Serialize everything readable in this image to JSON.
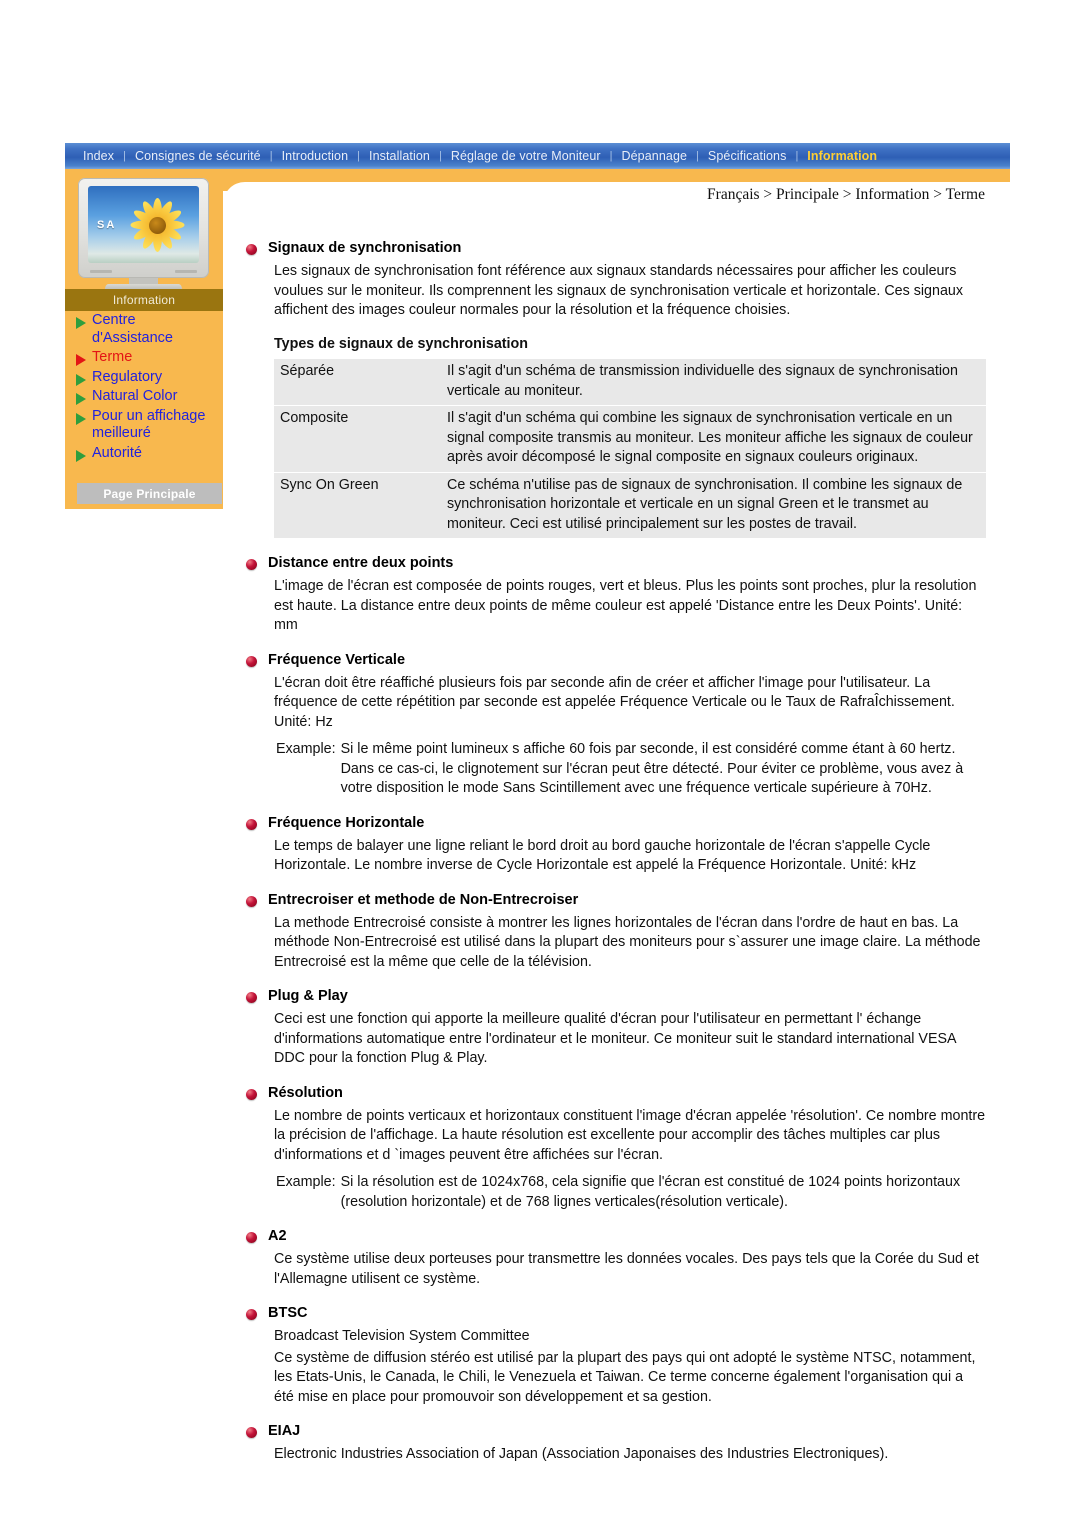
{
  "nav": {
    "items": [
      {
        "label": "Index",
        "active": false
      },
      {
        "label": "Consignes de sécurité",
        "active": false
      },
      {
        "label": "Introduction",
        "active": false
      },
      {
        "label": "Installation",
        "active": false
      },
      {
        "label": "Réglage de votre Moniteur",
        "active": false
      },
      {
        "label": "Dépannage",
        "active": false
      },
      {
        "label": "Spécifications",
        "active": false
      },
      {
        "label": "Information",
        "active": true
      }
    ],
    "separator": "|",
    "active_color": "#ffcf33",
    "bar_color": "#2e5fb5"
  },
  "sidebar": {
    "panel_color": "#f8b84e",
    "monitor": {
      "brand_text": "SA",
      "icon": "crt-monitor-sunflower"
    },
    "section_label": "Information",
    "section_label_bg": "#9a7510",
    "links": [
      {
        "label": "Centre\nd'Assistance",
        "current": false
      },
      {
        "label": "Terme",
        "current": true
      },
      {
        "label": "Regulatory",
        "current": false
      },
      {
        "label": "Natural Color",
        "current": false
      },
      {
        "label": "Pour un affichage\nmeilleuré",
        "current": false
      },
      {
        "label": "Autorité",
        "current": false
      }
    ],
    "link_color": "#2222dd",
    "current_color": "#e31515",
    "main_page_button": "Page Principale"
  },
  "breadcrumb": "Français > Principale > Information > Terme",
  "content": {
    "sections": [
      {
        "title": "Signaux de synchronisation",
        "paragraphs": [
          "Les signaux de synchronisation font référence aux signaux standards nécessaires pour afficher les couleurs voulues sur le moniteur. Ils comprennent les signaux de synchronisation verticale et horizontale. Ces signaux affichent des images couleur normales pour la résolution et la fréquence choisies."
        ],
        "subtitle": "Types de signaux de synchronisation",
        "table": {
          "rows": [
            {
              "key": "Séparée",
              "value": "Il s'agit d'un schéma de transmission individuelle des signaux de synchronisation verticale au moniteur."
            },
            {
              "key": "Composite",
              "value": "Il s'agit d'un schéma qui combine les signaux de synchronisation verticale en un signal composite transmis au moniteur. Les moniteur affiche les signaux de couleur après avoir décomposé le signal composite en signaux couleurs originaux."
            },
            {
              "key": "Sync On Green",
              "value": "Ce schéma n'utilise pas de signaux de synchronisation. Il combine les signaux de synchronisation horizontale et verticale en un signal Green et le transmet au moniteur. Ceci est utilisé principalement sur les postes de travail."
            }
          ]
        }
      },
      {
        "title": "Distance entre deux points",
        "paragraphs": [
          "L'image de l'écran est composée de points rouges, vert et bleus. Plus les points sont proches, plur la resolution est haute. La distance entre deux points de même couleur est appelé 'Distance entre les Deux Points'. Unité: mm"
        ]
      },
      {
        "title": "Fréquence Verticale",
        "paragraphs": [
          "L'écran doit être réaffiché plusieurs fois par seconde afin de créer et afficher l'image pour l'utilisateur. La fréquence de cette répétition par seconde est appelée Fréquence Verticale ou le Taux de RafraÎchissement. Unité: Hz"
        ],
        "example": {
          "key": "Example:",
          "body": "Si le même point lumineux s affiche 60 fois par seconde, il est considéré comme étant à 60 hertz. Dans ce cas-ci, le clignotement sur l'écran peut être détecté. Pour éviter ce problème, vous avez à votre disposition le mode Sans Scintillement avec une fréquence verticale supérieure à 70Hz."
        }
      },
      {
        "title": "Fréquence Horizontale",
        "paragraphs": [
          "Le temps de balayer une ligne reliant le bord droit au bord gauche horizontale de l'écran s'appelle Cycle Horizontale. Le nombre inverse de Cycle Horizontale est appelé la Fréquence Horizontale. Unité: kHz"
        ]
      },
      {
        "title": "Entrecroiser et methode de Non-Entrecroiser",
        "paragraphs": [
          "La methode Entrecroisé consiste à montrer les lignes horizontales de l'écran dans l'ordre de haut en bas. La méthode Non-Entrecroisé est utilisé dans la plupart des moniteurs pour s`assurer une image claire. La méthode Entrecroisé est la même que celle de la télévision."
        ]
      },
      {
        "title": "Plug & Play",
        "paragraphs": [
          "Ceci est une fonction qui apporte la meilleure qualité d'écran pour l'utilisateur en permettant l' échange d'informations automatique entre l'ordinateur et le moniteur. Ce moniteur suit le standard international VESA DDC pour la fonction Plug & Play."
        ]
      },
      {
        "title": "Résolution",
        "paragraphs": [
          "Le nombre de points verticaux et horizontaux constituent l'image d'écran appelée 'résolution'. Ce nombre montre la précision de l'affichage. La haute résolution est excellente pour accomplir des tâches multiples car plus d'informations et d `images peuvent être affichées sur l'écran."
        ],
        "example": {
          "key": "Example:",
          "body": "Si la résolution est de 1024x768, cela signifie que l'écran est constitué de 1024 points horizontaux (resolution horizontale) et de 768 lignes verticales(résolution verticale)."
        }
      },
      {
        "title": "A2",
        "paragraphs": [
          "Ce système utilise deux porteuses pour transmettre les données vocales. Des pays tels que la Corée du Sud et l'Allemagne utilisent ce système."
        ]
      },
      {
        "title": "BTSC",
        "paragraphs": [
          "Broadcast Television System Committee",
          "Ce système de diffusion stéréo est utilisé par la plupart des pays qui ont adopté le système NTSC, notamment, les Etats-Unis, le Canada, le Chili, le Venezuela et Taiwan. Ce terme concerne également l'organisation qui a été mise en place pour promouvoir son développement et sa gestion."
        ]
      },
      {
        "title": "EIAJ",
        "paragraphs": [
          "Electronic Industries Association of Japan (Association Japonaises des Industries Electroniques)."
        ]
      }
    ]
  }
}
